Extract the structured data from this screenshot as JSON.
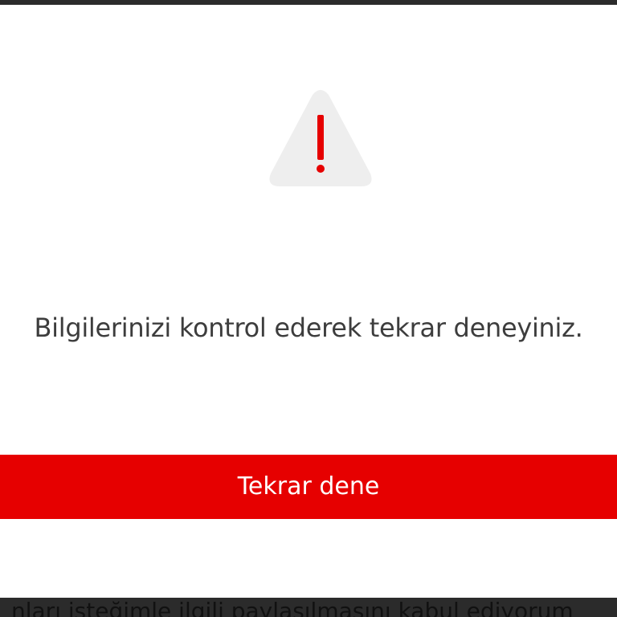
{
  "modal": {
    "message": "Bilgilerinizi kontrol ederek tekrar deneyiniz.",
    "retry_label": "Tekrar dene",
    "icon": "warning-triangle-icon"
  },
  "background_page": {
    "partial_text": "nları isteğimle ilgili paylaşılmasını kabul ediyorum"
  },
  "colors": {
    "accent": "#e60000",
    "icon_fill": "#eeeeee",
    "text": "#3d3d3d",
    "overlay": "#2b2b2b"
  }
}
